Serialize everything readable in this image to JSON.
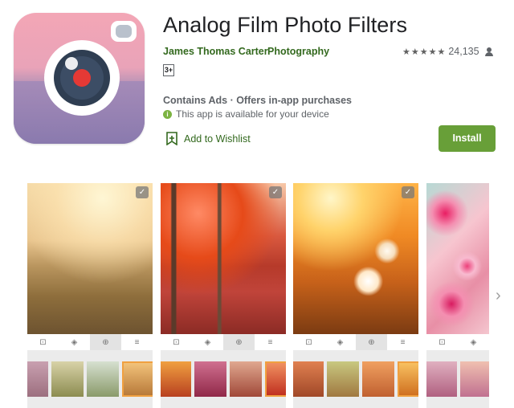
{
  "app": {
    "title": "Analog Film Photo Filters",
    "developer": "James Thomas Carter",
    "category": "Photography",
    "rating_stars": "★★★★★",
    "rating_count": "24,135",
    "age_rating": "3+",
    "ads_notice": "Contains Ads · Offers in-app purchases",
    "availability": "This app is available for your device",
    "wishlist_label": "Add to Wishlist",
    "install_label": "Install"
  },
  "colors": {
    "brand_green": "#689f38",
    "link_green": "#33691e"
  },
  "screenshots": [
    {
      "icon": "check-icon",
      "toolbar": [
        "camera-icon",
        "layers-icon",
        "lock-icon",
        "sliders-icon"
      ]
    },
    {
      "icon": "check-icon",
      "toolbar": [
        "camera-icon",
        "layers-icon",
        "lock-icon",
        "sliders-icon"
      ]
    },
    {
      "icon": "check-icon",
      "toolbar": [
        "camera-icon",
        "layers-icon",
        "lock-icon",
        "sliders-icon"
      ]
    },
    {
      "icon": "",
      "toolbar": [
        "camera-icon",
        "layers-icon",
        "lock-icon",
        "sliders-icon"
      ]
    }
  ],
  "nav": {
    "next_icon": "chevron-right-icon"
  }
}
